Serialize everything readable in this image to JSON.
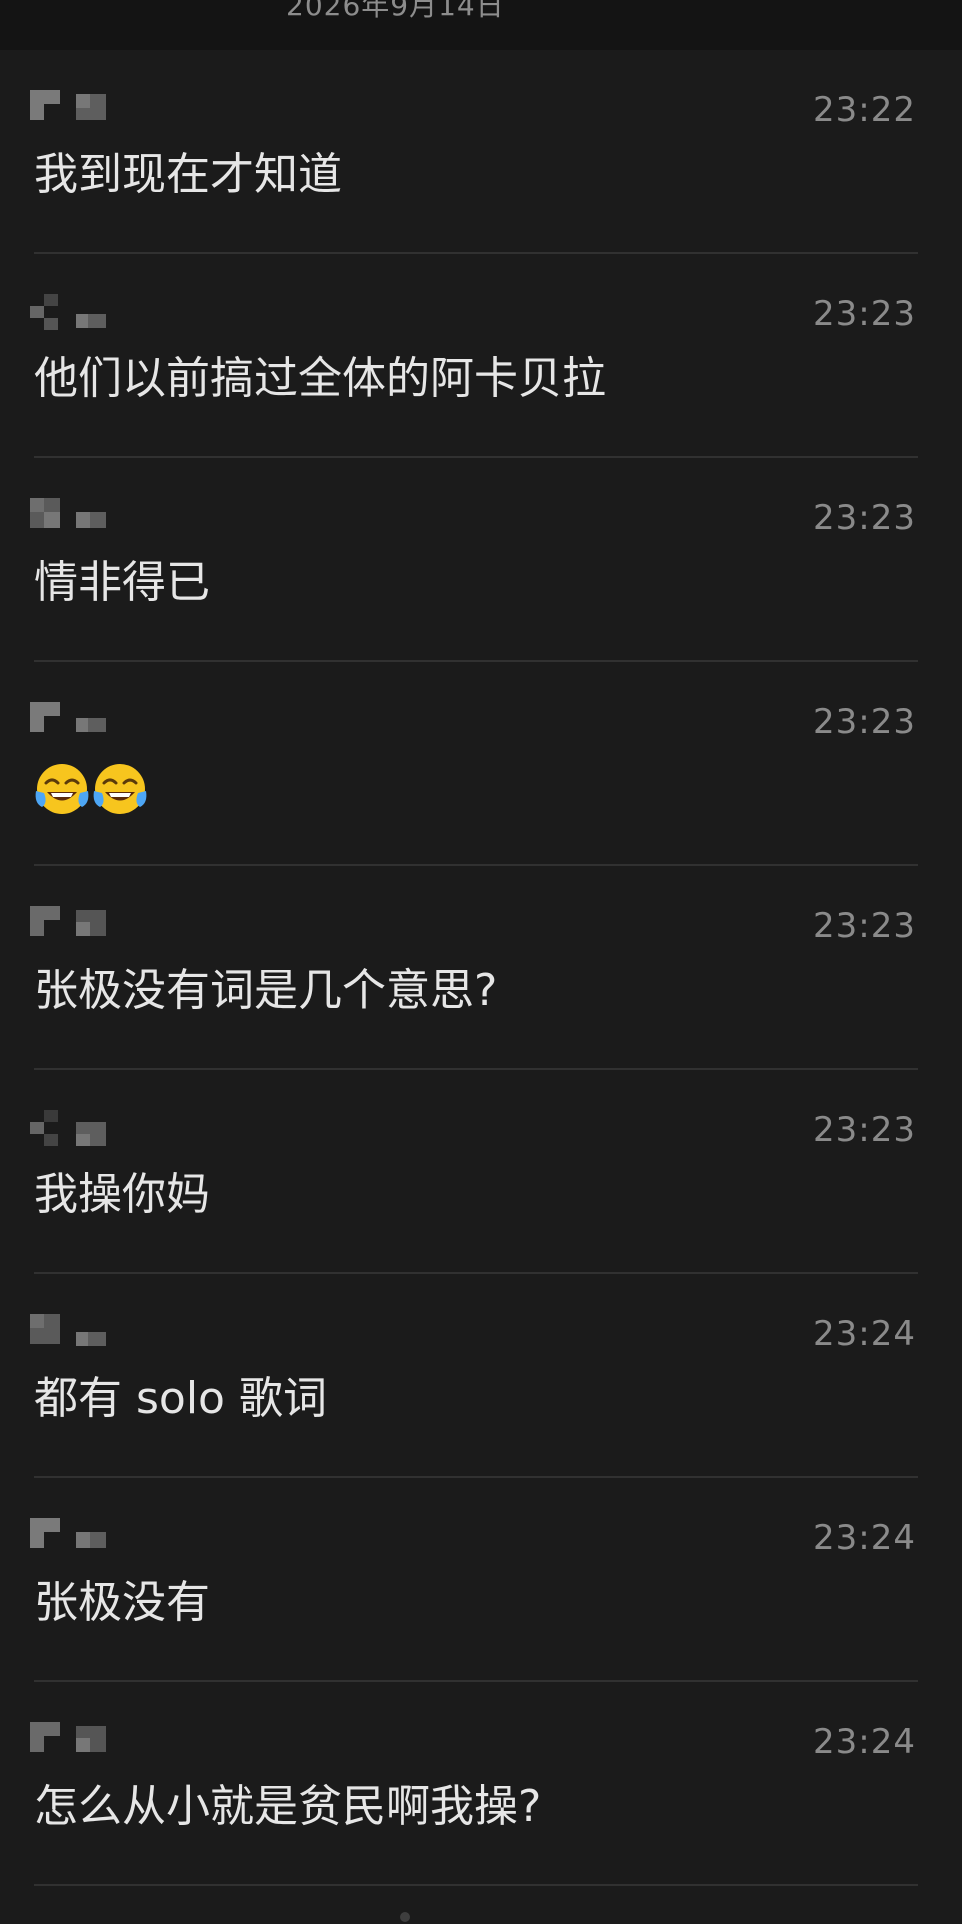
{
  "header": {
    "date": "2026年9月14日"
  },
  "messages": [
    {
      "time": "23:22",
      "text": "我到现在才知道"
    },
    {
      "time": "23:23",
      "text": "他们以前搞过全体的阿卡贝拉"
    },
    {
      "time": "23:23",
      "text": "情非得已"
    },
    {
      "time": "23:23",
      "text": "",
      "emojis": [
        "face-with-tears-of-joy",
        "face-with-tears-of-joy"
      ]
    },
    {
      "time": "23:23",
      "text": "张极没有词是几个意思?"
    },
    {
      "time": "23:23",
      "text": "我操你妈"
    },
    {
      "time": "23:24",
      "text": "都有 solo 歌词"
    },
    {
      "time": "23:24",
      "text": "张极没有"
    },
    {
      "time": "23:24",
      "text": "怎么从小就是贫民啊我操?"
    }
  ],
  "colors": {
    "background": "#1b1b1b",
    "header_background": "#141414",
    "text": "#e6e6e6",
    "timestamp": "#8a8a8a",
    "divider": "#313131"
  }
}
